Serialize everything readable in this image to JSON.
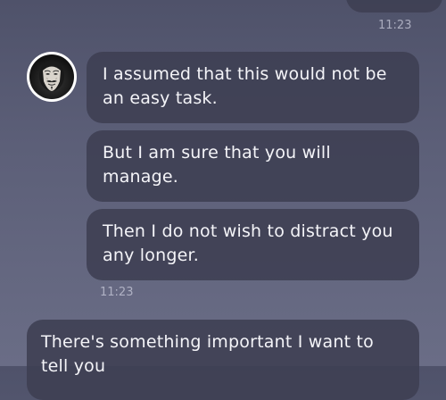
{
  "chat": {
    "top_outgoing": {
      "time": "11:23"
    },
    "incoming_group": {
      "avatar_icon": "anonymous-mask-avatar",
      "messages": [
        {
          "text": "I assumed that this would not be an easy task."
        },
        {
          "text": "But I am sure that you will manage."
        },
        {
          "text": "Then I do not wish to distract you any longer."
        }
      ],
      "time": "11:23"
    },
    "bottom_outgoing": {
      "text": "There's something important I want to tell you"
    }
  },
  "colors": {
    "background_top": "#4f526a",
    "background_bottom": "#6a6d86",
    "bubble": "#3e3f52",
    "text": "#f4f4f8",
    "timestamp": "#c8cada"
  }
}
